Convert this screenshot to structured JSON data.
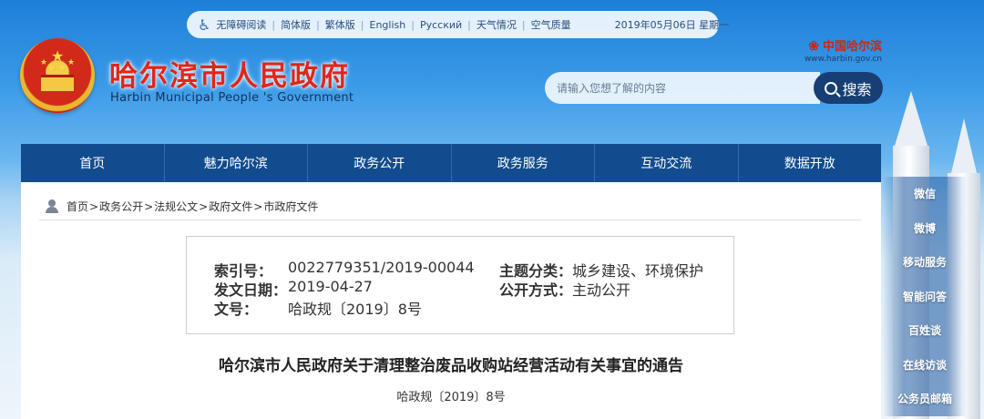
{
  "topbar": {
    "items": [
      "无障碍阅读",
      "简体版",
      "繁体版",
      "English",
      "Русский",
      "天气情况",
      "空气质量"
    ],
    "date": "2019年05月06日 星期一"
  },
  "header": {
    "title": "哈尔滨市人民政府",
    "subtitle": "Harbin Municipal People 's Government"
  },
  "brand": {
    "name": "中国哈尔滨",
    "url": "www.harbin.gov.cn"
  },
  "search": {
    "placeholder": "请输入您想了解的内容",
    "button_label": "搜索"
  },
  "nav": {
    "items": [
      "首页",
      "魅力哈尔滨",
      "政务公开",
      "政务服务",
      "互动交流",
      "数据开放"
    ]
  },
  "breadcrumb": [
    "首页",
    "政务公开",
    "法规公文",
    "政府文件",
    "市政府文件"
  ],
  "info": {
    "index_label": "索引号：",
    "index_value": "0022779351/2019-00044",
    "topic_label": "主题分类：",
    "topic_value": "城乡建设、环境保护",
    "date_label": "发文日期：",
    "date_value": "2019-04-27",
    "method_label": "公开方式：",
    "method_value": "主动公开",
    "docno_label": "文号：",
    "docno_value": "哈政规〔2019〕8号"
  },
  "document": {
    "title": "哈尔滨市人民政府关于清理整治废品收购站经营活动有关事宜的通告",
    "number": "哈政规〔2019〕8号"
  },
  "sidemenu": {
    "items": [
      "微信",
      "微博",
      "移动服务",
      "智能问答",
      "百姓谈",
      "在线访谈",
      "公务员邮箱"
    ]
  },
  "colors": {
    "nav_bg": "#124c8e",
    "title_red": "#e0261a",
    "search_button": "#173f75"
  }
}
